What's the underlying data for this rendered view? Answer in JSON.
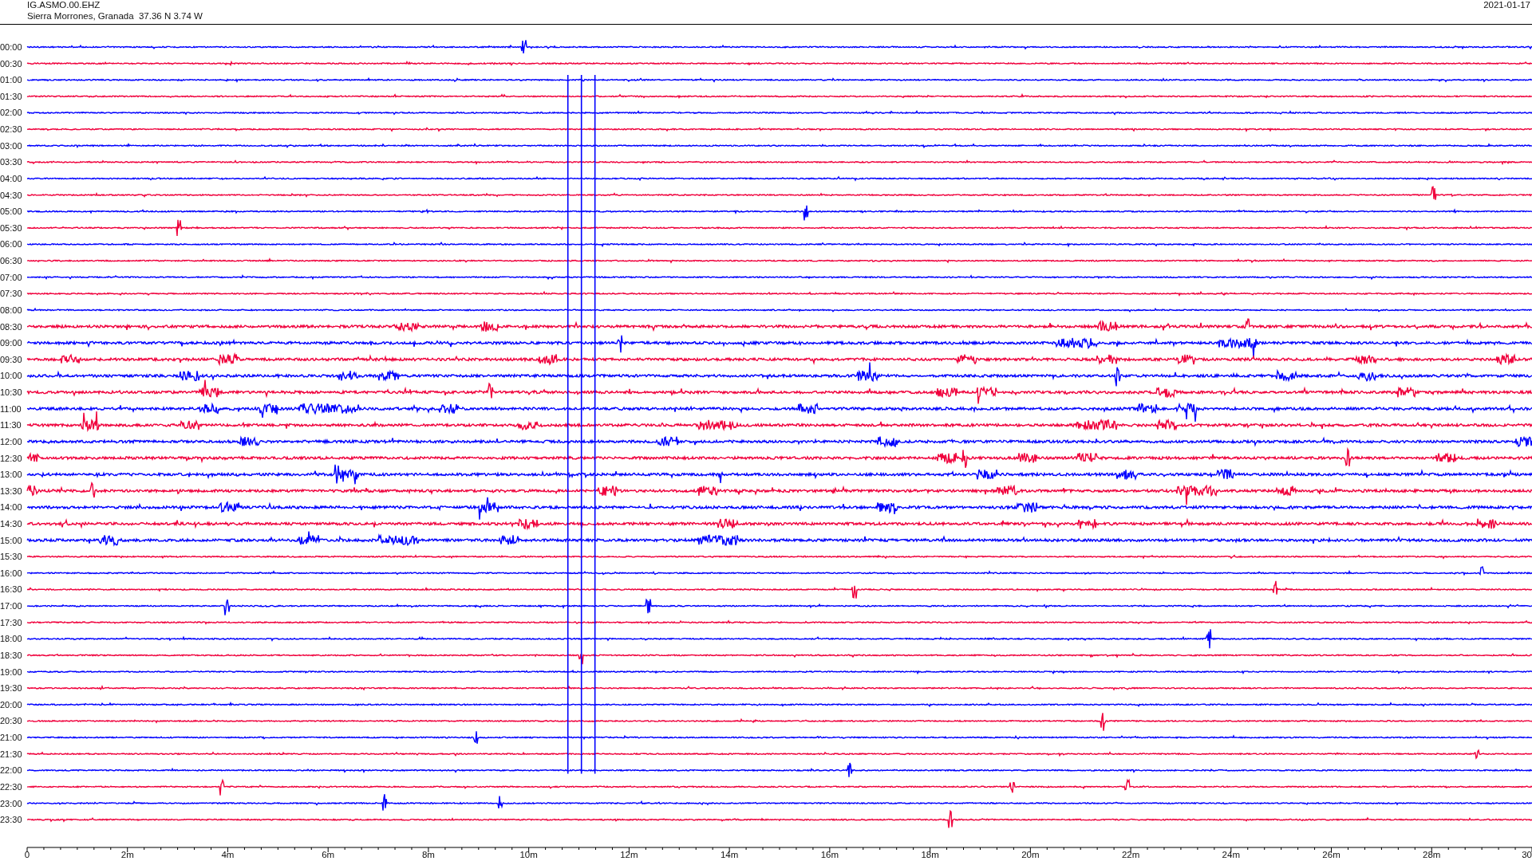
{
  "header": {
    "station": "IG.ASMO.00.EHZ",
    "location": "Sierra Morrones, Granada  37.36 N 3.74 W",
    "date": "2021-01-17"
  },
  "rows": [
    {
      "time": "00:00",
      "color": "#0000ff"
    },
    {
      "time": "00:30",
      "color": "#f0003c"
    },
    {
      "time": "01:00",
      "color": "#0000ff"
    },
    {
      "time": "01:30",
      "color": "#f0003c"
    },
    {
      "time": "02:00",
      "color": "#0000ff"
    },
    {
      "time": "02:30",
      "color": "#f0003c"
    },
    {
      "time": "03:00",
      "color": "#0000ff"
    },
    {
      "time": "03:30",
      "color": "#f0003c"
    },
    {
      "time": "04:00",
      "color": "#0000ff"
    },
    {
      "time": "04:30",
      "color": "#f0003c"
    },
    {
      "time": "05:00",
      "color": "#0000ff"
    },
    {
      "time": "05:30",
      "color": "#f0003c"
    },
    {
      "time": "06:00",
      "color": "#0000ff"
    },
    {
      "time": "06:30",
      "color": "#f0003c"
    },
    {
      "time": "07:00",
      "color": "#0000ff"
    },
    {
      "time": "07:30",
      "color": "#f0003c"
    },
    {
      "time": "08:00",
      "color": "#0000ff"
    },
    {
      "time": "08:30",
      "color": "#f0003c"
    },
    {
      "time": "09:00",
      "color": "#0000ff"
    },
    {
      "time": "09:30",
      "color": "#f0003c"
    },
    {
      "time": "10:00",
      "color": "#0000ff"
    },
    {
      "time": "10:30",
      "color": "#f0003c"
    },
    {
      "time": "11:00",
      "color": "#0000ff"
    },
    {
      "time": "11:30",
      "color": "#f0003c"
    },
    {
      "time": "12:00",
      "color": "#0000ff"
    },
    {
      "time": "12:30",
      "color": "#f0003c"
    },
    {
      "time": "13:00",
      "color": "#0000ff"
    },
    {
      "time": "13:30",
      "color": "#f0003c"
    },
    {
      "time": "14:00",
      "color": "#0000ff"
    },
    {
      "time": "14:30",
      "color": "#f0003c"
    },
    {
      "time": "15:00",
      "color": "#0000ff"
    },
    {
      "time": "15:30",
      "color": "#f0003c"
    },
    {
      "time": "16:00",
      "color": "#0000ff"
    },
    {
      "time": "16:30",
      "color": "#f0003c"
    },
    {
      "time": "17:00",
      "color": "#0000ff"
    },
    {
      "time": "17:30",
      "color": "#f0003c"
    },
    {
      "time": "18:00",
      "color": "#0000ff"
    },
    {
      "time": "18:30",
      "color": "#f0003c"
    },
    {
      "time": "19:00",
      "color": "#0000ff"
    },
    {
      "time": "19:30",
      "color": "#f0003c"
    },
    {
      "time": "20:00",
      "color": "#0000ff"
    },
    {
      "time": "20:30",
      "color": "#f0003c"
    },
    {
      "time": "21:00",
      "color": "#0000ff"
    },
    {
      "time": "21:30",
      "color": "#f0003c"
    },
    {
      "time": "22:00",
      "color": "#0000ff"
    },
    {
      "time": "22:30",
      "color": "#f0003c"
    },
    {
      "time": "23:00",
      "color": "#0000ff"
    },
    {
      "time": "23:30",
      "color": "#f0003c"
    }
  ],
  "x_axis": {
    "labels": [
      "0",
      "2m",
      "4m",
      "6m",
      "8m",
      "10m",
      "12m",
      "14m",
      "16m",
      "18m",
      "20m",
      "22m",
      "24m",
      "26m",
      "28m",
      "30"
    ]
  }
}
